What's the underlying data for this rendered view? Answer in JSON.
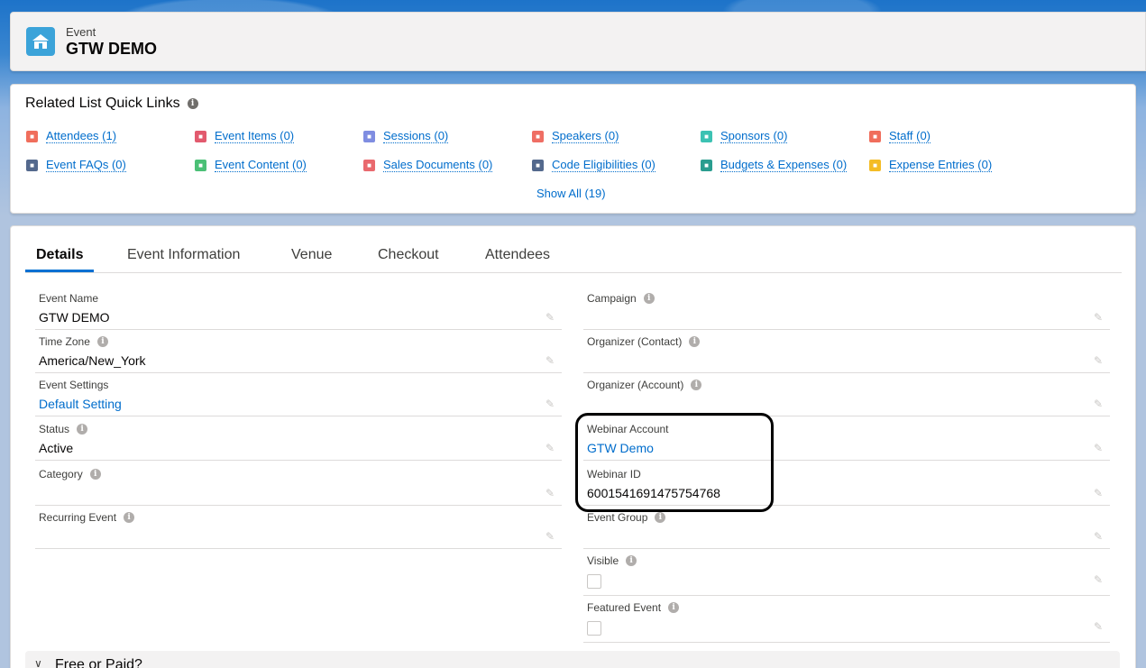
{
  "header": {
    "object_type": "Event",
    "record_name": "GTW DEMO"
  },
  "quick_links": {
    "title": "Related List Quick Links",
    "items": [
      {
        "label": "Attendees (1)",
        "icon": "attendees-icon",
        "color": "#f06e5c"
      },
      {
        "label": "Event Items (0)",
        "icon": "event-items-icon",
        "color": "#e25a6e"
      },
      {
        "label": "Sessions (0)",
        "icon": "sessions-icon",
        "color": "#7f8de1"
      },
      {
        "label": "Speakers (0)",
        "icon": "speakers-icon",
        "color": "#ef6e64"
      },
      {
        "label": "Sponsors (0)",
        "icon": "sponsors-icon",
        "color": "#3cc2b3"
      },
      {
        "label": "Staff (0)",
        "icon": "staff-icon",
        "color": "#f06e5c"
      },
      {
        "label": "Event FAQs (0)",
        "icon": "wrench-icon",
        "color": "#54698d"
      },
      {
        "label": "Event Content (0)",
        "icon": "content-icon",
        "color": "#4bc076"
      },
      {
        "label": "Sales Documents (0)",
        "icon": "pencil-icon",
        "color": "#e9696e"
      },
      {
        "label": "Code Eligibilities (0)",
        "icon": "wrench-icon",
        "color": "#54698d"
      },
      {
        "label": "Budgets & Expenses (0)",
        "icon": "budget-icon",
        "color": "#2a9d8f"
      },
      {
        "label": "Expense Entries (0)",
        "icon": "expense-icon",
        "color": "#f4bc25"
      }
    ],
    "show_all": "Show All (19)"
  },
  "tabs": [
    "Details",
    "Event Information",
    "Venue",
    "Checkout",
    "Attendees"
  ],
  "left_fields": [
    {
      "label": "Event Name",
      "value": "GTW DEMO",
      "info": false,
      "link": false
    },
    {
      "label": "Time Zone",
      "value": "America/New_York",
      "info": true,
      "link": false
    },
    {
      "label": "Event Settings",
      "value": "Default Setting",
      "info": false,
      "link": true
    },
    {
      "label": "Status",
      "value": "Active",
      "info": true,
      "link": false
    },
    {
      "label": "Category",
      "value": "",
      "info": true,
      "link": false
    },
    {
      "label": "Recurring Event",
      "value": "",
      "info": true,
      "link": false
    }
  ],
  "right_fields": [
    {
      "label": "Campaign",
      "value": "",
      "info": true,
      "link": false
    },
    {
      "label": "Organizer (Contact)",
      "value": "",
      "info": true,
      "link": false
    },
    {
      "label": "Organizer (Account)",
      "value": "",
      "info": true,
      "link": false
    },
    {
      "label": "Webinar Account",
      "value": "GTW Demo",
      "info": false,
      "link": true
    },
    {
      "label": "Webinar ID",
      "value": "6001541691475754768",
      "info": false,
      "link": false
    },
    {
      "label": "Event Group",
      "value": "",
      "info": true,
      "link": false
    },
    {
      "label": "Visible",
      "value": "",
      "info": true,
      "checkbox": true
    },
    {
      "label": "Featured Event",
      "value": "",
      "info": true,
      "checkbox": true
    }
  ],
  "section": {
    "label": "Free or Paid?"
  }
}
